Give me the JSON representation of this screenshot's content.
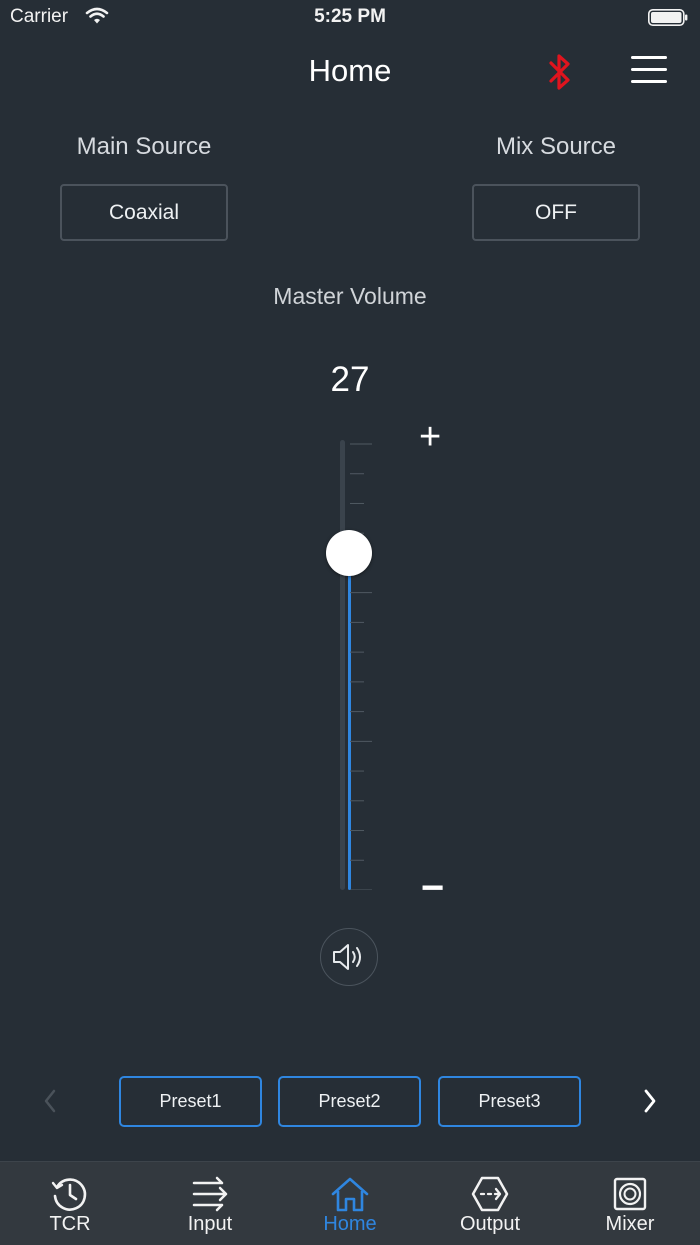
{
  "status_bar": {
    "carrier": "Carrier",
    "time": "5:25 PM"
  },
  "header": {
    "title": "Home"
  },
  "sources": {
    "main_label": "Main Source",
    "main_value": "Coaxial",
    "mix_label": "Mix Source",
    "mix_value": "OFF"
  },
  "volume": {
    "label": "Master Volume",
    "value": "27",
    "plus": "+",
    "minus": "−",
    "level_fraction": 0.75
  },
  "presets": {
    "items": [
      "Preset1",
      "Preset2",
      "Preset3"
    ],
    "prev": "‹",
    "next": "›"
  },
  "tabs": [
    {
      "label": "TCR",
      "icon": "clock-icon"
    },
    {
      "label": "Input",
      "icon": "input-arrows-icon"
    },
    {
      "label": "Home",
      "icon": "home-icon",
      "active": true
    },
    {
      "label": "Output",
      "icon": "output-icon"
    },
    {
      "label": "Mixer",
      "icon": "speaker-box-icon"
    }
  ],
  "colors": {
    "accent": "#2f86e0",
    "bluetooth": "#e0141e",
    "background": "#262e36"
  }
}
